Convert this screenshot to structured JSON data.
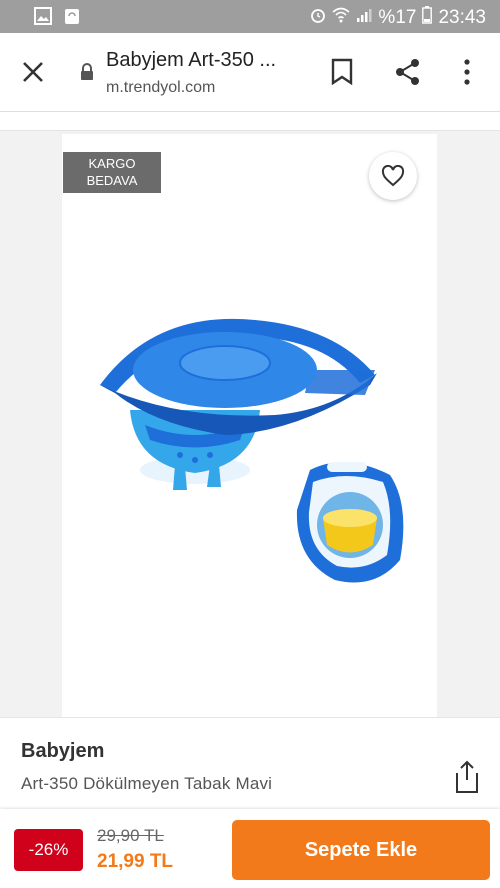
{
  "status_bar": {
    "battery_percent": "%17",
    "time": "23:43"
  },
  "browser": {
    "page_title": "Babyjem Art-350 ...",
    "domain": "m.trendyol.com"
  },
  "product": {
    "badge": "KARGO BEDAVA",
    "badge_line1": "KARGO",
    "badge_line2": "BEDAVA",
    "brand": "Babyjem",
    "name": "Art-350 Dökülmeyen Tabak Mavi"
  },
  "pricing": {
    "discount": "-26%",
    "old_price": "29,90 TL",
    "new_price": "21,99 TL",
    "add_to_cart_label": "Sepete Ekle"
  },
  "colors": {
    "accent": "#f27a1a",
    "discount": "#d0021b",
    "badge": "#6b6b6b",
    "product_blue": "#1e6fd9"
  }
}
